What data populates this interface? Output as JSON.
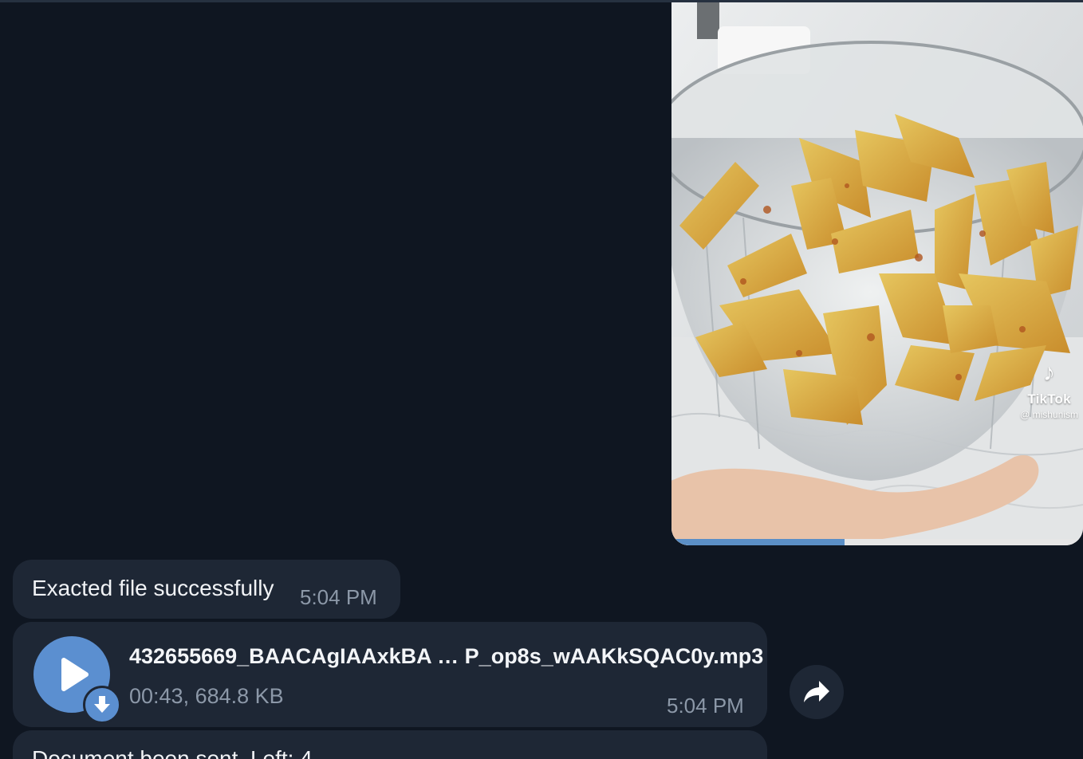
{
  "video": {
    "watermark_brand": "TikTok",
    "watermark_handle": "@ mishunism",
    "progress": 0.42
  },
  "messages": [
    {
      "text": "Exacted file successfully",
      "time": "5:04 PM"
    },
    {
      "file_name": "432655669_BAACAgIAAxkBA … P_op8s_wAAKkSQAC0y.mp3",
      "file_meta": "00:43, 684.8 KB",
      "time": "5:04 PM"
    },
    {
      "text": "Document been sent. Left: 4"
    }
  ],
  "icons": {
    "play": "play-icon",
    "download": "download-arrow-icon",
    "forward": "forward-arrow-icon",
    "tiktok": "tiktok-logo-icon"
  },
  "colors": {
    "background": "#0f1621",
    "bubble": "#1e2735",
    "accent": "#5b8fd0",
    "muted_text": "#8c98a8"
  }
}
